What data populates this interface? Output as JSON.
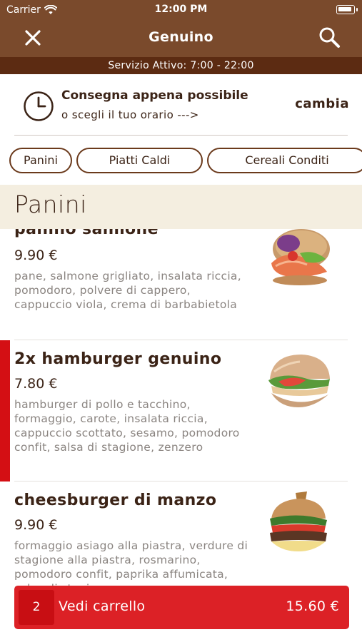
{
  "status_bar": {
    "carrier": "Carrier",
    "time": "12:00 PM"
  },
  "nav": {
    "title": "Genuino",
    "close_icon": "close-icon",
    "search_icon": "search-icon"
  },
  "service": {
    "text": "Servizio Attivo: 7:00 - 22:00"
  },
  "delivery": {
    "title": "Consegna appena possibile",
    "subtitle": "o scegli il tuo orario --->",
    "change_label": "cambia",
    "icon": "clock-icon"
  },
  "categories": [
    "Panini",
    "Piatti Caldi",
    "Cereali Conditi"
  ],
  "section": {
    "title": "Panini"
  },
  "items": [
    {
      "name": "panino salmone",
      "price": "9.90 €",
      "description": "pane, salmone grigliato, insalata riccia, pomodoro, polvere di cappero, cappuccio viola, crema di barbabietola",
      "selected": false
    },
    {
      "name": "2x hamburger genuino",
      "price": "7.80 €",
      "description": "hamburger di pollo e tacchino, formaggio, carote, insalata riccia, cappuccio scottato, sesamo, pomodoro confit, salsa di stagione, zenzero",
      "selected": true
    },
    {
      "name": "cheesburger di manzo",
      "price": "9.90 €",
      "description": "formaggio asiago alla piastra, verdure di stagione alla piastra, rosmarino, pomodoro confit, paprika affumicata, salsa di stagione",
      "selected": false
    }
  ],
  "cart": {
    "count": "2",
    "label": "Vedi carrello",
    "total": "15.60 €"
  },
  "colors": {
    "header_brown": "#7a4a2c",
    "service_brown": "#5c2b12",
    "accent_red": "#dc2126",
    "section_bg": "#f4eee0"
  }
}
